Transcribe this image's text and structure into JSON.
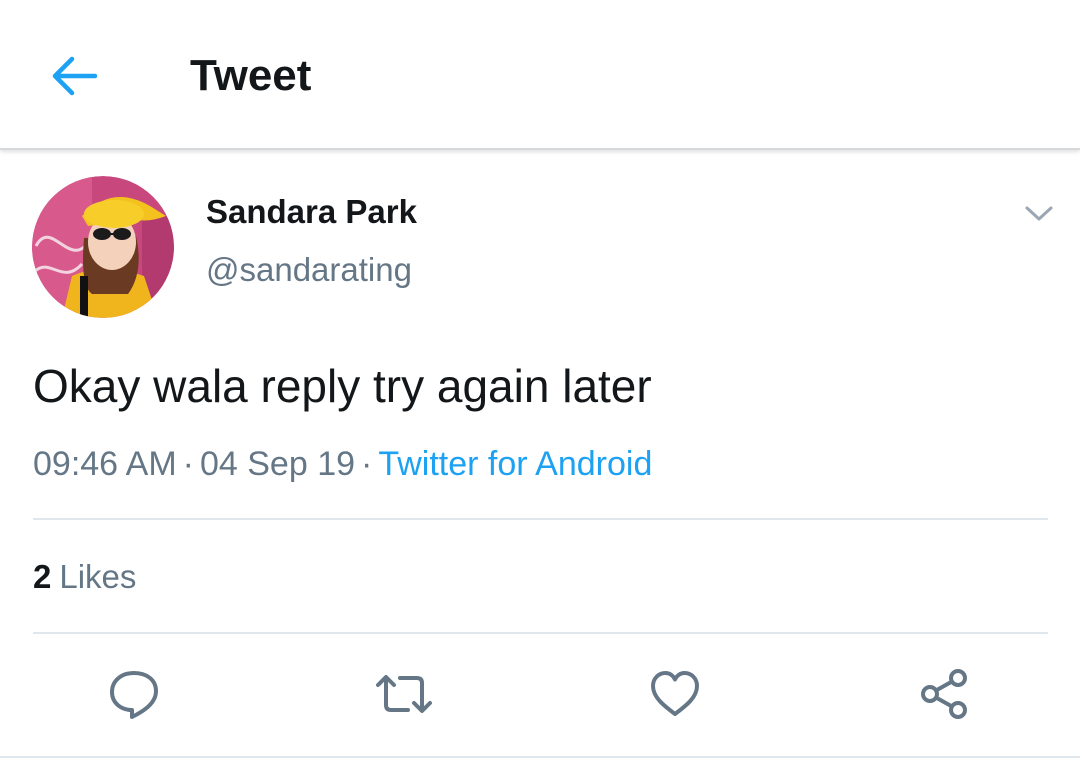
{
  "header": {
    "title": "Tweet",
    "back_icon": "arrow-left-icon",
    "accent_color": "#1da1f2"
  },
  "tweet": {
    "author": {
      "display_name": "Sandara Park",
      "handle": "@sandarating",
      "avatar": "profile-photo"
    },
    "menu_icon": "chevron-down-icon",
    "text": "Okay wala reply try again later",
    "meta": {
      "time": "09:46 AM",
      "separator": "·",
      "date": "04 Sep 19",
      "client": "Twitter for Android"
    },
    "stats": {
      "likes_count": "2",
      "likes_label": "Likes"
    },
    "actions": {
      "reply_icon": "reply-icon",
      "retweet_icon": "retweet-icon",
      "like_icon": "heart-icon",
      "share_icon": "share-icon"
    }
  },
  "colors": {
    "text_primary": "#14171a",
    "text_secondary": "#657786",
    "link": "#1da1f2",
    "divider": "#e1e8ed"
  }
}
